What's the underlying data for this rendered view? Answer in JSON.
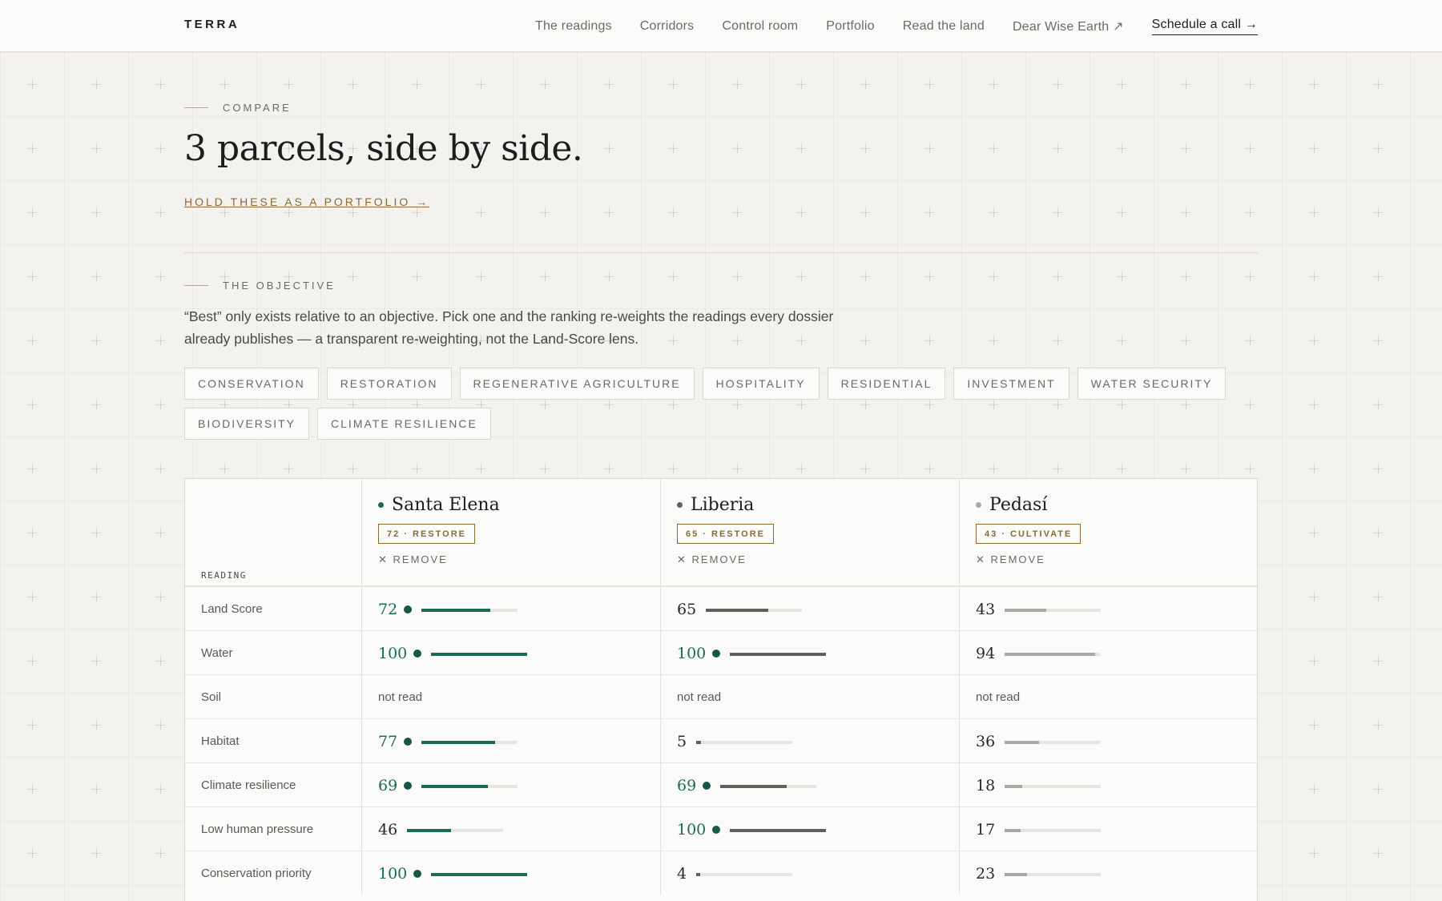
{
  "header": {
    "brand": "TERRA",
    "nav": [
      {
        "label": "The readings"
      },
      {
        "label": "Corridors"
      },
      {
        "label": "Control room"
      },
      {
        "label": "Portfolio"
      },
      {
        "label": "Read the land"
      },
      {
        "label": "Dear Wise Earth ↗"
      }
    ],
    "cta": "Schedule a call →"
  },
  "intro": {
    "eyebrow": "COMPARE",
    "title": "3 parcels, side by side.",
    "portfolio_link": "HOLD THESE AS A PORTFOLIO →"
  },
  "objective": {
    "eyebrow": "THE OBJECTIVE",
    "description": "“Best” only exists relative to an objective. Pick one and the ranking re-weights the readings every dossier already publishes — a transparent re-weighting, not the Land-Score lens.",
    "options": [
      "CONSERVATION",
      "RESTORATION",
      "REGENERATIVE AGRICULTURE",
      "HOSPITALITY",
      "RESIDENTIAL",
      "INVESTMENT",
      "WATER SECURITY",
      "BIODIVERSITY",
      "CLIMATE RESILIENCE"
    ]
  },
  "table": {
    "reading_header": "READING",
    "remove_label": "✕ REMOVE",
    "parcels": [
      {
        "name": "Santa Elena",
        "tag": "72 · RESTORE",
        "dot_color": "#1c6a56",
        "bar_color": "#1c6a56"
      },
      {
        "name": "Liberia",
        "tag": "65 · RESTORE",
        "dot_color": "#5f625c",
        "bar_color": "#5f625c"
      },
      {
        "name": "Pedasí",
        "tag": "43 · CULTIVATE",
        "dot_color": "#a7aaa4",
        "bar_color": "#a7aaa4"
      }
    ],
    "not_read_label": "not read",
    "rows": [
      {
        "label": "Land Score",
        "values": [
          72,
          65,
          43
        ],
        "best": [
          true,
          false,
          false
        ]
      },
      {
        "label": "Water",
        "values": [
          100,
          100,
          94
        ],
        "best": [
          true,
          true,
          false
        ]
      },
      {
        "label": "Soil",
        "values": [
          null,
          null,
          null
        ],
        "best": [
          false,
          false,
          false
        ]
      },
      {
        "label": "Habitat",
        "values": [
          77,
          5,
          36
        ],
        "best": [
          true,
          false,
          false
        ]
      },
      {
        "label": "Climate resilience",
        "values": [
          69,
          69,
          18
        ],
        "best": [
          true,
          true,
          false
        ]
      },
      {
        "label": "Low human pressure",
        "values": [
          46,
          100,
          17
        ],
        "best": [
          false,
          true,
          false
        ]
      },
      {
        "label": "Conservation priority",
        "values": [
          100,
          4,
          23
        ],
        "best": [
          true,
          false,
          false
        ]
      }
    ]
  }
}
